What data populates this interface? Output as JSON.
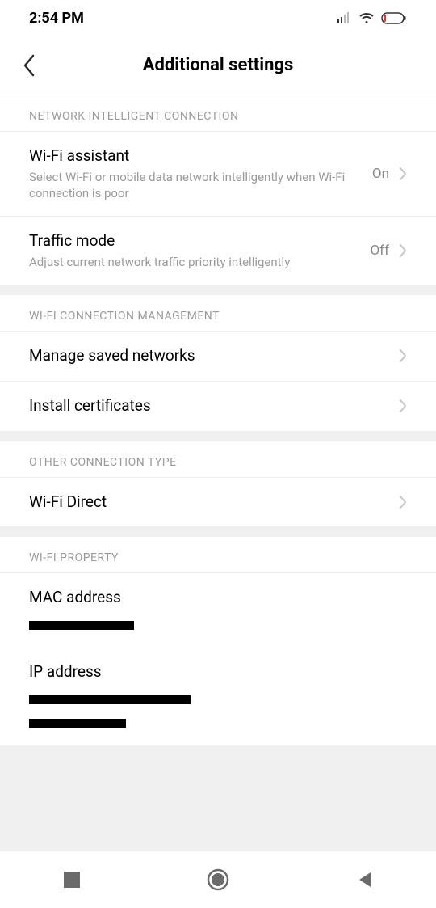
{
  "status": {
    "time": "2:54 PM"
  },
  "header": {
    "title": "Additional settings"
  },
  "sections": {
    "network_intelligent": {
      "header": "NETWORK INTELLIGENT CONNECTION",
      "wifi_assistant": {
        "title": "Wi-Fi assistant",
        "subtitle": "Select Wi-Fi or mobile data network intelligently when Wi-Fi connection is poor",
        "value": "On"
      },
      "traffic_mode": {
        "title": "Traffic mode",
        "subtitle": "Adjust current network traffic priority intelligently",
        "value": "Off"
      }
    },
    "wifi_management": {
      "header": "WI-FI CONNECTION MANAGEMENT",
      "manage_saved": {
        "title": "Manage saved networks"
      },
      "install_certs": {
        "title": "Install certificates"
      }
    },
    "other_connection": {
      "header": "OTHER CONNECTION TYPE",
      "wifi_direct": {
        "title": "Wi-Fi Direct"
      }
    },
    "wifi_property": {
      "header": "WI-FI PROPERTY",
      "mac": {
        "title": "MAC address"
      },
      "ip": {
        "title": "IP address"
      }
    }
  }
}
